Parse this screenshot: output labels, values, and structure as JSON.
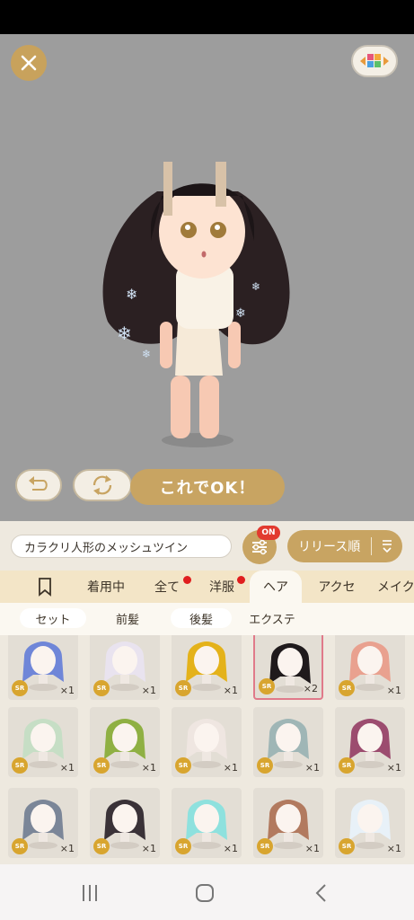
{
  "stage": {
    "ok_label": "これでOK！"
  },
  "item_name": "カラクリ人形のメッシュツイン",
  "filter": {
    "badge": "ON"
  },
  "sort": {
    "label": "リリース順"
  },
  "tabs": [
    {
      "label": "着用中",
      "dot": false
    },
    {
      "label": "全て",
      "dot": true
    },
    {
      "label": "洋服",
      "dot": true
    },
    {
      "label": "ヘア",
      "dot": false,
      "active": true
    },
    {
      "label": "アクセ",
      "dot": false
    },
    {
      "label": "メイク",
      "dot": false
    }
  ],
  "subtabs": [
    {
      "label": "セット"
    },
    {
      "label": "前髪"
    },
    {
      "label": "後髪"
    },
    {
      "label": "エクステ"
    }
  ],
  "items": [
    {
      "rarity": "SR",
      "count": "×1",
      "color": "#6f86d8"
    },
    {
      "rarity": "SR",
      "count": "×1",
      "color": "#e9e3ef"
    },
    {
      "rarity": "SR",
      "count": "×1",
      "color": "#e4b21a"
    },
    {
      "rarity": "SR",
      "count": "×2",
      "color": "#1f1a1c",
      "equipped": true
    },
    {
      "rarity": "SR",
      "count": "×1",
      "color": "#e9a18f"
    },
    {
      "rarity": "SR",
      "count": "×1",
      "color": "#c6dec5"
    },
    {
      "rarity": "SR",
      "count": "×1",
      "color": "#8fb043"
    },
    {
      "rarity": "SR",
      "count": "×1",
      "color": "#efe6e1"
    },
    {
      "rarity": "SR",
      "count": "×1",
      "color": "#9fb6b6"
    },
    {
      "rarity": "SR",
      "count": "×1",
      "color": "#9c4c6f"
    },
    {
      "rarity": "SR",
      "count": "×1",
      "color": "#7b8698"
    },
    {
      "rarity": "SR",
      "count": "×1",
      "color": "#3a3238"
    },
    {
      "rarity": "SR",
      "count": "×1",
      "color": "#8ee1de"
    },
    {
      "rarity": "SR",
      "count": "×1",
      "color": "#b27a5f"
    },
    {
      "rarity": "SR",
      "count": "×1",
      "color": "#e8f1f8"
    }
  ],
  "colors": {
    "gold": "#c8a462",
    "stage_bg": "#9d9d9d",
    "tab_bg": "#f3e5c7",
    "panel_bg": "#eee9df",
    "alert": "#e01e1e"
  },
  "icons": [
    "close-icon",
    "background-palette-icon",
    "undo-icon",
    "rotate-icon",
    "filter-sliders-icon",
    "sort-icon",
    "bookmark-icon",
    "nav-recents-icon",
    "nav-home-icon",
    "nav-back-icon"
  ]
}
